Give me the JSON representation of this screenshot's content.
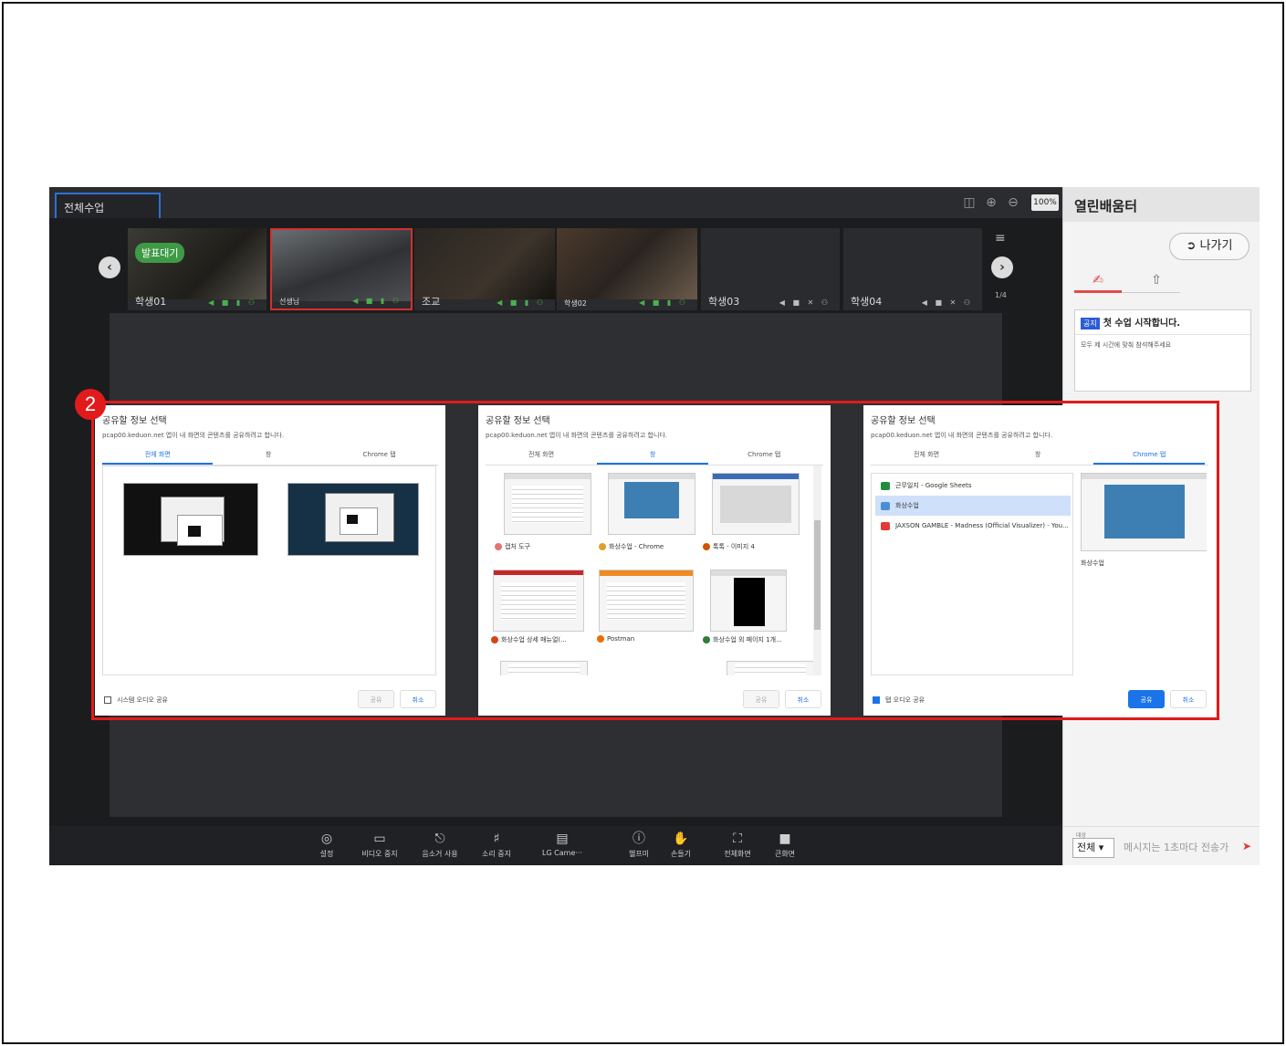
{
  "app": {
    "tab_label": "전체수업",
    "zoom_level": "100%",
    "room_title": "열린배움터",
    "exit_label": "나가기",
    "page_indicator": "1/4"
  },
  "participants": [
    {
      "name": "학생01",
      "badge": "발표대기"
    },
    {
      "name": "선생님"
    },
    {
      "name": "조교"
    },
    {
      "name": "학생02"
    },
    {
      "name": "학생03"
    },
    {
      "name": "학생04"
    }
  ],
  "notice": {
    "tag": "공지",
    "title": "첫 수업 시작합니다.",
    "body": "모두 제 시간에 맞춰 참석해주세요"
  },
  "chat": {
    "target_label": "대상",
    "target_value": "전체",
    "placeholder": "메시지는 1초마다 전송가"
  },
  "toolbar": [
    {
      "label": "설정",
      "icon": "gear-icon"
    },
    {
      "label": "비디오 중지",
      "icon": "camera-icon"
    },
    {
      "label": "음소거 사용",
      "icon": "mic-icon"
    },
    {
      "label": "소리 중지",
      "icon": "speaker-icon"
    },
    {
      "label": "LG Came···",
      "icon": "screen-share-icon"
    },
    {
      "label": "헬프미",
      "icon": "help-icon"
    },
    {
      "label": "손들기",
      "icon": "hand-icon"
    },
    {
      "label": "전체화면",
      "icon": "fullscreen-icon"
    },
    {
      "label": "큰화면",
      "icon": "big-screen-icon"
    }
  ],
  "step_number": "2",
  "share_dialogs": [
    {
      "title": "공유할 정보 선택",
      "subtitle": "pcap00.keduon.net 앱이 내 화면의 콘텐츠를 공유하려고 합니다.",
      "tabs": [
        "전체 화면",
        "창",
        "Chrome 탭"
      ],
      "active_tab": 0,
      "audio_label": "시스템 오디오 공유",
      "audio_checked": false,
      "share_label": "공유",
      "cancel_label": "취소",
      "share_enabled": false
    },
    {
      "title": "공유할 정보 선택",
      "subtitle": "pcap00.keduon.net 앱이 내 화면의 콘텐츠를 공유하려고 합니다.",
      "tabs": [
        "전체 화면",
        "창",
        "Chrome 탭"
      ],
      "active_tab": 1,
      "windows": [
        "캡처 도구",
        "화상수업 - Chrome",
        "톡톡 - 이미지 4",
        "화상수업 상세 매뉴얼(...",
        "Postman",
        "화상수업 외 페이지 1개..."
      ],
      "share_label": "공유",
      "cancel_label": "취소",
      "share_enabled": false
    },
    {
      "title": "공유할 정보 선택",
      "subtitle": "pcap00.keduon.net 앱이 내 화면의 콘텐츠를 공유하려고 합니다.",
      "tabs": [
        "전체 화면",
        "창",
        "Chrome 탭"
      ],
      "active_tab": 2,
      "chrome_tabs": [
        "근무일지 - Google Sheets",
        "화상수업",
        "JAXSON GAMBLE - Madness (Official Visualizer) - You..."
      ],
      "selected_tab": 1,
      "preview_label": "화상수업",
      "audio_label": "탭 오디오 공유",
      "audio_checked": true,
      "share_label": "공유",
      "cancel_label": "취소",
      "share_enabled": true
    }
  ]
}
